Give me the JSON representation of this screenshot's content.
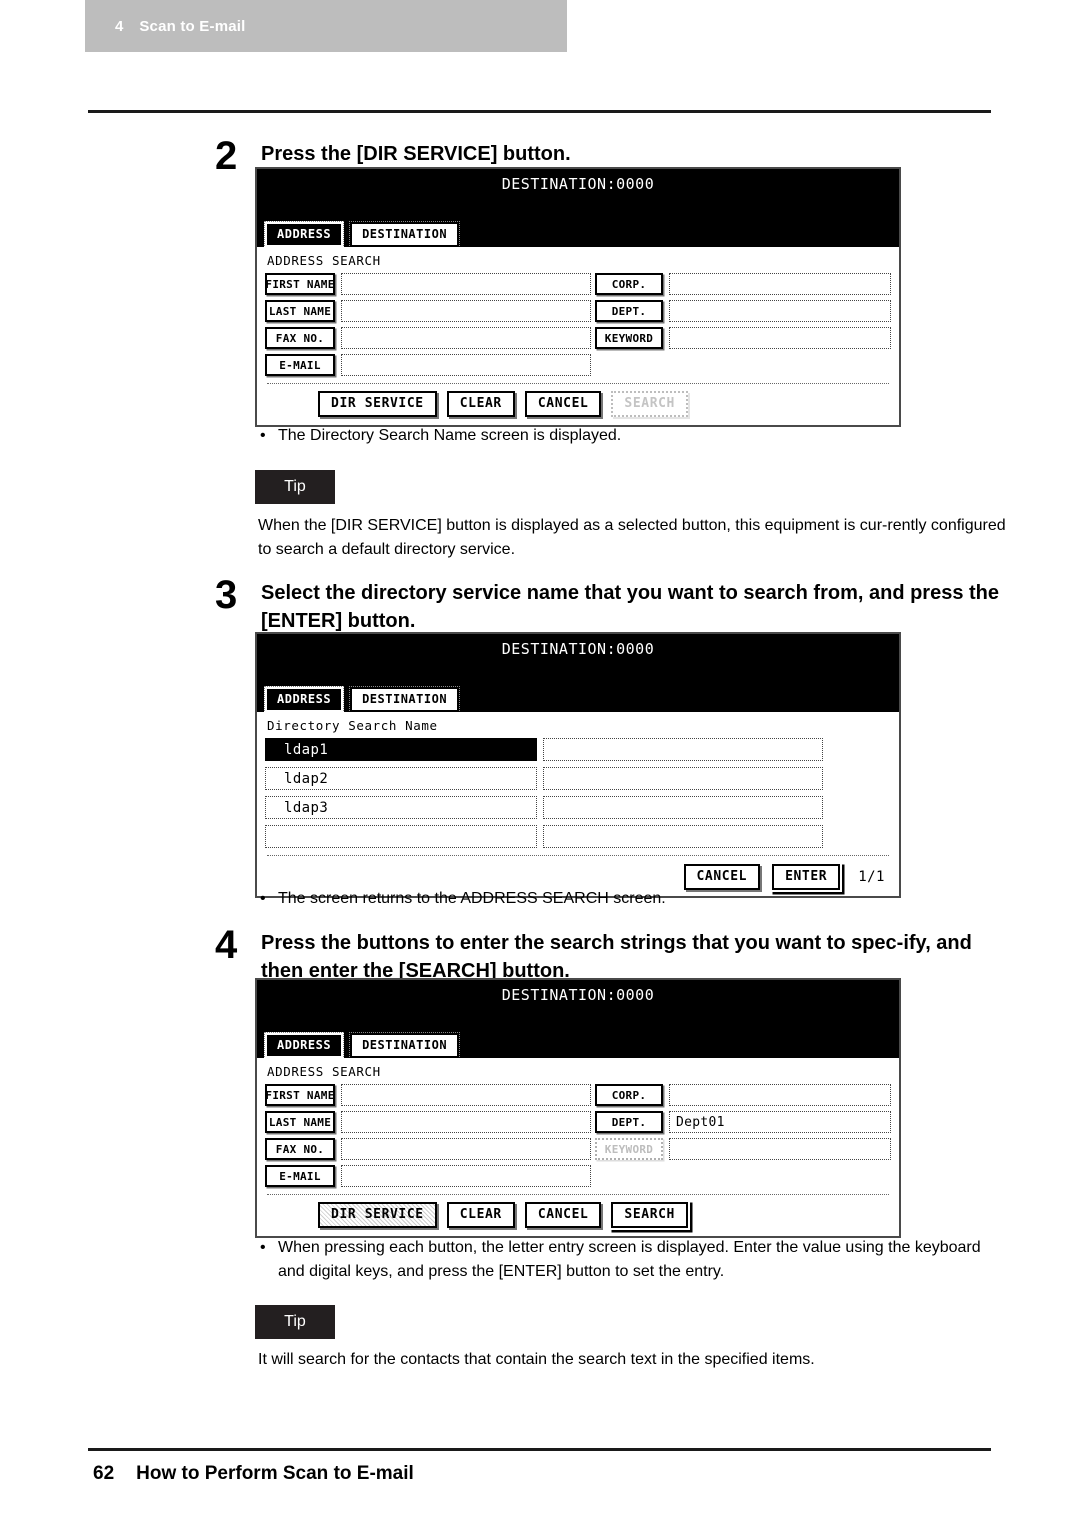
{
  "header": {
    "chapter_number": "4",
    "chapter_title": "Scan to E-mail"
  },
  "footer": {
    "page_number": "62",
    "section_title": "How to Perform Scan to E-mail"
  },
  "steps": [
    {
      "number": "2",
      "title": "Press the [DIR SERVICE] button.",
      "note_bullet": "•",
      "note": "The Directory Search Name screen is displayed."
    },
    {
      "number": "3",
      "title": "Select the directory service name that you want to search from, and press the [ENTER] button.",
      "note_bullet": "•",
      "note": "The screen returns to the ADDRESS SEARCH screen."
    },
    {
      "number": "4",
      "title": "Press the buttons to enter the search strings that you want to spec-ify, and then enter the [SEARCH] button.",
      "note_bullet": "•",
      "note": "When pressing each button, the letter entry screen is displayed.  Enter the value using the keyboard and digital keys, and press the [ENTER] button to set the entry."
    }
  ],
  "tips": [
    {
      "label": "Tip",
      "text": "When the [DIR SERVICE] button is displayed as a selected button, this equipment is cur-rently configured to search a default directory service."
    },
    {
      "label": "Tip",
      "text": "It will search for the contacts that contain the search text in the specified items."
    }
  ],
  "panel_address_search": {
    "destination_label": "DESTINATION:0000",
    "tabs": [
      {
        "label": "ADDRESS",
        "selected": true
      },
      {
        "label": "DESTINATION",
        "selected": false
      }
    ],
    "caption": "ADDRESS SEARCH",
    "left_fields": [
      {
        "button": "FIRST NAME",
        "value": ""
      },
      {
        "button": "LAST NAME",
        "value": ""
      },
      {
        "button": "FAX NO.",
        "value": ""
      },
      {
        "button": "E-MAIL",
        "value": ""
      }
    ],
    "right_fields": [
      {
        "button": "CORP.",
        "value": ""
      },
      {
        "button": "DEPT.",
        "value": ""
      },
      {
        "button": "KEYWORD",
        "value": ""
      }
    ],
    "actions": [
      {
        "label": "DIR SERVICE",
        "state": "normal"
      },
      {
        "label": "CLEAR",
        "state": "normal"
      },
      {
        "label": "CANCEL",
        "state": "normal"
      },
      {
        "label": "SEARCH",
        "state": "disabled"
      }
    ]
  },
  "panel_directory_search": {
    "destination_label": "DESTINATION:0000",
    "tabs": [
      {
        "label": "ADDRESS",
        "selected": true
      },
      {
        "label": "DESTINATION",
        "selected": false
      }
    ],
    "caption": "Directory Search Name",
    "rows": [
      {
        "name": "ldap1",
        "value": "",
        "selected": true
      },
      {
        "name": "ldap2",
        "value": "",
        "selected": false
      },
      {
        "name": "ldap3",
        "value": "",
        "selected": false
      },
      {
        "name": "",
        "value": "",
        "selected": false
      }
    ],
    "actions": [
      {
        "label": "CANCEL",
        "state": "normal"
      },
      {
        "label": "ENTER",
        "state": "default"
      }
    ],
    "page_indicator": "1/1"
  },
  "panel_address_search_filled": {
    "destination_label": "DESTINATION:0000",
    "tabs": [
      {
        "label": "ADDRESS",
        "selected": true
      },
      {
        "label": "DESTINATION",
        "selected": false
      }
    ],
    "caption": "ADDRESS SEARCH",
    "left_fields": [
      {
        "button": "FIRST NAME",
        "value": ""
      },
      {
        "button": "LAST NAME",
        "value": ""
      },
      {
        "button": "FAX NO.",
        "value": ""
      },
      {
        "button": "E-MAIL",
        "value": ""
      }
    ],
    "right_fields": [
      {
        "button": "CORP.",
        "value": ""
      },
      {
        "button": "DEPT.",
        "value": "Dept01"
      },
      {
        "button": "KEYWORD",
        "value": "",
        "disabled": true
      }
    ],
    "actions": [
      {
        "label": "DIR SERVICE",
        "state": "pressed"
      },
      {
        "label": "CLEAR",
        "state": "normal"
      },
      {
        "label": "CANCEL",
        "state": "normal"
      },
      {
        "label": "SEARCH",
        "state": "default"
      }
    ]
  },
  "colors": {
    "header_bar": "#bdbdbd",
    "tip_bg": "#231f20",
    "rule": "#1a1a1a",
    "lcd_header": "#000000"
  }
}
